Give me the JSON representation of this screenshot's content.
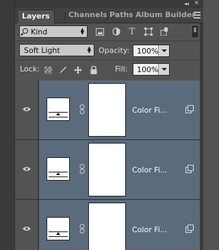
{
  "tabs": [
    {
      "label": "Layers",
      "active": true
    },
    {
      "label": "Channels",
      "active": false
    },
    {
      "label": "Paths",
      "active": false
    },
    {
      "label": "Album Builder",
      "active": false
    }
  ],
  "window_controls": {
    "collapse": "◂◂",
    "close": "✕"
  },
  "filter": {
    "kind_label": "Kind",
    "icons": [
      "pixel-filter-icon",
      "adjustment-filter-icon",
      "type-filter-icon",
      "shape-filter-icon",
      "smart-object-filter-icon"
    ],
    "type_glyph": "T"
  },
  "blend": {
    "mode": "Soft Light",
    "opacity_label": "Opacity:",
    "opacity_value": "100%"
  },
  "lock": {
    "label": "Lock:",
    "fill_label": "Fill:",
    "fill_value": "100%"
  },
  "layers": [
    {
      "name": "Color Fi...",
      "visible": true
    },
    {
      "name": "Color Fi...",
      "visible": true
    },
    {
      "name": "Color Fi...",
      "visible": true
    }
  ],
  "colors": {
    "panel_bg": "#535353",
    "selected_layer_bg": "#5b6b7c",
    "tab_active_text": "#f0f0f0"
  }
}
